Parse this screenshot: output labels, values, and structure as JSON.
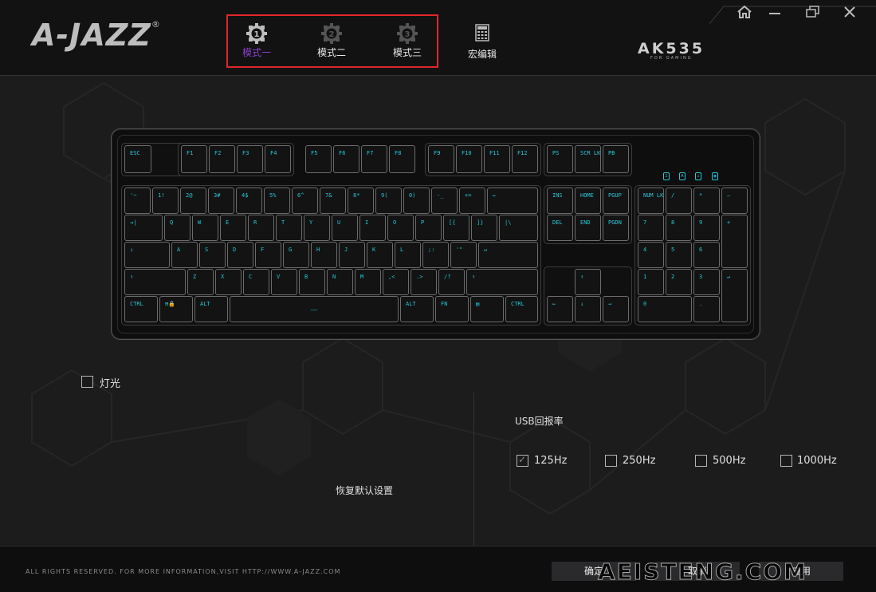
{
  "brand": {
    "logo": "A-JAZZ",
    "reg": "®",
    "model": "AK535",
    "model_sub": "FOR GAMING"
  },
  "modes": [
    {
      "label": "模式一",
      "num": "1",
      "active": true
    },
    {
      "label": "模式二",
      "num": "2",
      "active": false
    },
    {
      "label": "模式三",
      "num": "3",
      "active": false
    }
  ],
  "macro": {
    "label": "宏编辑"
  },
  "window": {
    "home_icon": "home-icon",
    "minimize_icon": "minimize-icon",
    "restore_icon": "restore-icon",
    "close_icon": "close-icon"
  },
  "keys": {
    "esc": "ESC",
    "f1": "F1",
    "f2": "F2",
    "f3": "F3",
    "f4": "F4",
    "f5": "F5",
    "f6": "F6",
    "f7": "F7",
    "f8": "F8",
    "f9": "F9",
    "f10": "F10",
    "f11": "F11",
    "f12": "F12",
    "ps": "PS",
    "scr": "SCR LK",
    "pb": "PB",
    "tilde": "'~",
    "n1": "1!",
    "n2": "2@",
    "n3": "3#",
    "n4": "4$",
    "n5": "5%",
    "n6": "6^",
    "n7": "7&",
    "n8": "8*",
    "n9": "9(",
    "n0": "0)",
    "minus": "-_",
    "equal": "+=",
    "back": "←",
    "tab": "⇥|",
    "q": "Q",
    "w": "W",
    "e": "E",
    "r": "R",
    "t": "T",
    "y": "Y",
    "u": "U",
    "i": "I",
    "o": "O",
    "p": "P",
    "lbr": "[{",
    "rbr": "]}",
    "bsl": "|\\",
    "caps": "↓",
    "a": "A",
    "s": "S",
    "d": "D",
    "f": "F",
    "g": "G",
    "h": "H",
    "j": "J",
    "k": "K",
    "l": "L",
    "semi": ";:",
    "quote": "'\"",
    "enter": "↵",
    "lshift": "↑",
    "z": "Z",
    "x": "X",
    "c": "C",
    "v": "V",
    "b": "B",
    "n": "N",
    "m": "M",
    "comma": ",<",
    "dot": ".>",
    "slash": "/?",
    "rshift": "↑",
    "lctrl": "CTRL",
    "win": "⊞🔒",
    "lalt": "ALT",
    "space": "——",
    "ralt": "ALT",
    "fn": "FN",
    "menu": "▤",
    "rctrl": "CTRL",
    "ins": "INS",
    "home": "HOME",
    "pgup": "PGUP",
    "del": "DEL",
    "end": "END",
    "pgdn": "PGDN",
    "up": "↑",
    "left": "←",
    "down": "↓",
    "right": "→",
    "numlk": "NUM LK",
    "ndiv": "/",
    "nmul": "*",
    "nsub": "—",
    "n_7": "7",
    "n_8": "8",
    "n_9": "9",
    "nadd": "+",
    "n_4": "4",
    "n_5": "5",
    "n_6": "6",
    "n_1": "1",
    "n_2": "2",
    "n_3": "3",
    "nenter": "↵",
    "n_0": "0",
    "ndot": "."
  },
  "leds": [
    "1",
    "A",
    "↓",
    "◉"
  ],
  "light": {
    "label": "灯光",
    "checked": false
  },
  "usb": {
    "title": "USB回报率",
    "options": [
      {
        "label": "125Hz",
        "checked": true
      },
      {
        "label": "250Hz",
        "checked": false
      },
      {
        "label": "500Hz",
        "checked": false
      },
      {
        "label": "1000Hz",
        "checked": false
      }
    ]
  },
  "restore": {
    "label": "恢复默认设置"
  },
  "footer": {
    "copyright": "ALL RIGHTS RESERVED. FOR MORE INFORMATION,VISIT HTTP://WWW.A-JAZZ.COM",
    "ok": "确定",
    "cancel": "取消",
    "apply": "应用"
  },
  "watermark": "AEISTENG.COM"
}
